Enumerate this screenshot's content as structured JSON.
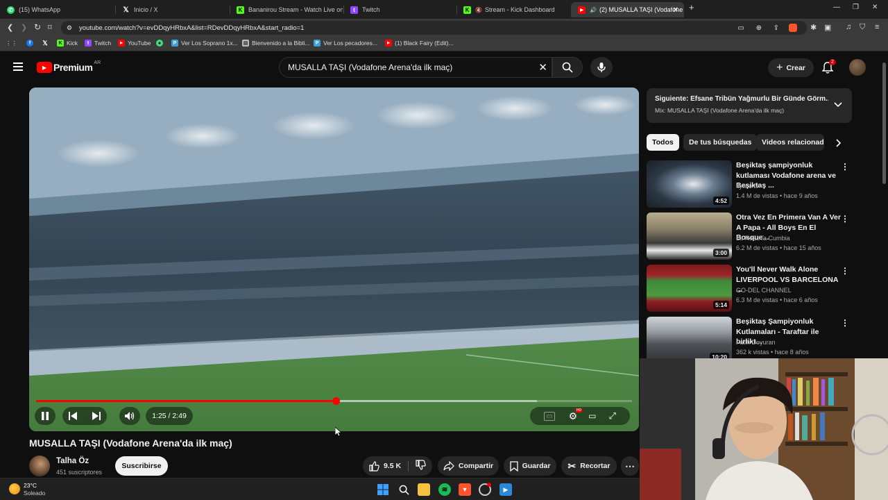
{
  "browser": {
    "tabs": [
      {
        "label": "(15) WhatsApp",
        "icon": "whatsapp-icon",
        "color": "#25d366"
      },
      {
        "label": "Inicio / X",
        "icon": "x-icon",
        "color": "#ffffff"
      },
      {
        "label": "Bananirou Stream - Watch Live on Ki",
        "icon": "kick-icon",
        "color": "#53fc18"
      },
      {
        "label": "Twitch",
        "icon": "twitch-icon",
        "color": "#9146ff"
      },
      {
        "label": "Stream - Kick Dashboard",
        "icon": "kick-icon",
        "color": "#53fc18"
      },
      {
        "label": "(2) MUSALLA TAŞI (Vodafone",
        "icon": "youtube-icon",
        "color": "#ff0000"
      }
    ],
    "url": "youtube.com/watch?v=evDDqyHRbxA&list=RDevDDqyHRbxA&start_radio=1",
    "bookmarks": [
      {
        "label": "",
        "icon": "facebook-icon",
        "color": "#1877f2"
      },
      {
        "label": "",
        "icon": "x-icon",
        "color": "#ffffff"
      },
      {
        "label": "Kick",
        "icon": "kick-icon",
        "color": "#53fc18"
      },
      {
        "label": "Twitch",
        "icon": "twitch-icon",
        "color": "#9146ff"
      },
      {
        "label": "YouTube",
        "icon": "youtube-icon",
        "color": "#ff0000"
      },
      {
        "label": "",
        "icon": "android-icon",
        "color": "#3ddc84"
      },
      {
        "label": "Ver Los Soprano 1x...",
        "icon": "bookmark-icon",
        "color": "#3ba1d8"
      },
      {
        "label": "Bienvenido a la Bibli...",
        "icon": "page-icon",
        "color": "#bbbbbb"
      },
      {
        "label": "Ver Los pecadores...",
        "icon": "bookmark-icon",
        "color": "#3ba1d8"
      },
      {
        "label": "(1) Black Fairy (Edit)...",
        "icon": "youtube-icon",
        "color": "#ff0000"
      }
    ]
  },
  "youtube": {
    "logo": "Premium",
    "region": "AR",
    "search_query": "MUSALLA TAŞI (Vodafone Arena'da ilk maç)",
    "create_label": "Crear",
    "notifications": "2"
  },
  "player": {
    "time": "1:25 / 2:49",
    "progress_fraction": 0.503,
    "buffer_fraction": 0.84,
    "accent": "#ff0000"
  },
  "video": {
    "title": "MUSALLA TAŞI (Vodafone Arena'da ilk maç)",
    "channel": "Talha Öz",
    "subscribers": "451 suscriptores",
    "subscribe_label": "Suscribirse",
    "likes": "9.5 K",
    "share_label": "Compartir",
    "save_label": "Guardar",
    "clip_label": "Recortar"
  },
  "sidebar": {
    "next_title": "Siguiente: Efsane Tribün Yağmurlu Bir Günde Görm...",
    "next_sub": "Mix: MUSALLA TAŞI (Vodafone Arena'da ilk maç)",
    "chips": [
      "Todos",
      "De tus búsquedas",
      "Videos relacionado"
    ],
    "recommendations": [
      {
        "title": "Beşiktaş şampiyonluk kutlaması Vodafone arena ve Beşiktaş ...",
        "channel": "flyline tv",
        "meta": "1.4 M de vistas • hace 9 años",
        "duration": "4:52"
      },
      {
        "title": "Otra Vez En Primera Van A Ver A Papa - All Boys En El Bosque...",
        "channel": "La ReZeTa Cumbia",
        "meta": "6.2 M de vistas • hace 15 años",
        "duration": "3:00"
      },
      {
        "title": "You'll Never Walk Alone LIVERPOOL VS BARCELONA ...",
        "channel": "GO-DEL CHANNEL",
        "meta": "6.3 M de vistas • hace 6 años",
        "duration": "5:14"
      },
      {
        "title": "Beşiktaş Şampiyonluk Kutlamaları - Taraftar ile birlikt...",
        "channel": "Fatih Doyuran",
        "meta": "362 k vistas • hace 8 años",
        "duration": "10:20"
      }
    ]
  },
  "taskbar": {
    "temperature": "23°C",
    "weather": "Soleado"
  }
}
